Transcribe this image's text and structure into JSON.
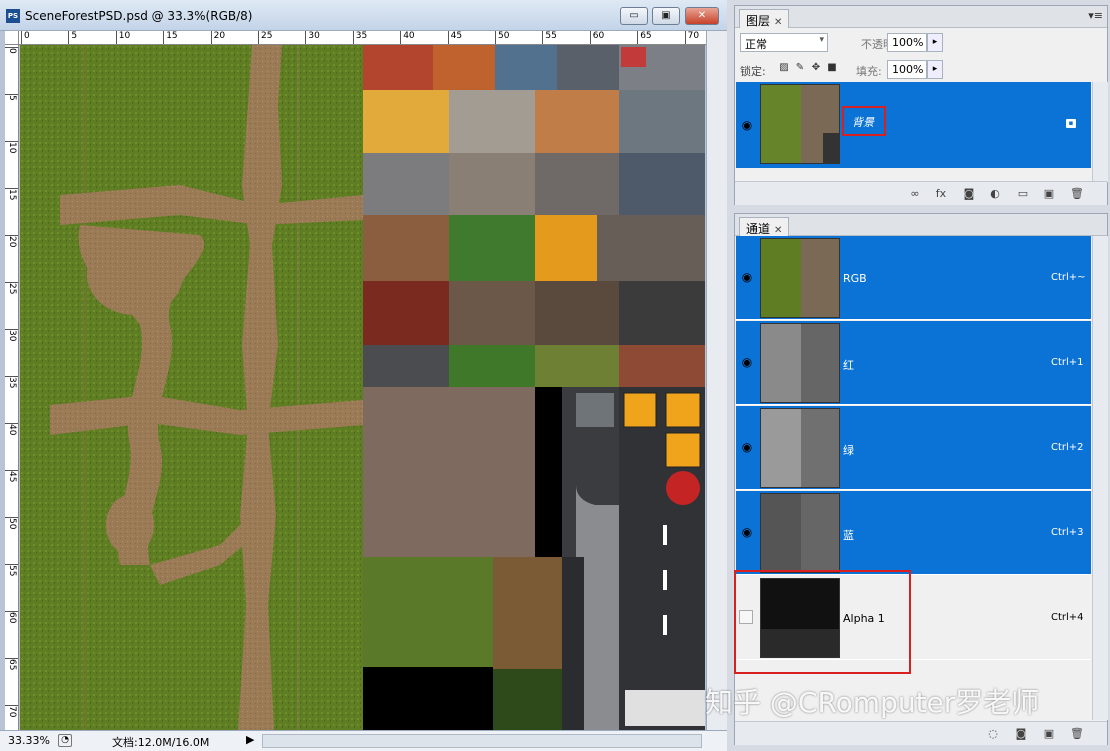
{
  "document": {
    "title": "SceneForestPSD.psd @ 33.3%(RGB/8)",
    "app_icon": "PS",
    "window_buttons": {
      "minimize": "▭",
      "maximize": "▣",
      "close": "✕"
    },
    "hruler_ticks": [
      "0",
      "5",
      "10",
      "15",
      "20",
      "25",
      "30",
      "35",
      "40",
      "45",
      "50",
      "55",
      "60",
      "65",
      "70"
    ],
    "vruler_ticks": [
      "0",
      "5",
      "10",
      "15",
      "20",
      "25",
      "30",
      "35",
      "40",
      "45",
      "50",
      "55",
      "60",
      "65",
      "70"
    ],
    "zoom": "33.33%",
    "doc_info": "文档:12.0M/16.0M",
    "status_arrow": "▶",
    "canvas_colors": {
      "grass": "#5e7a22",
      "path": "#9b7a56",
      "road": "#3a3c3f"
    }
  },
  "layers_panel": {
    "tab_label": "图层",
    "tab_close": "✕",
    "menu": "▾≡",
    "blend_mode": "正常",
    "opacity_label": "不透明度:",
    "opacity_value": "100%",
    "lock_label": "锁定:",
    "fill_label": "填充:",
    "fill_value": "100%",
    "layer": {
      "name": "背景",
      "visible_icon": "eye-icon",
      "locked": true
    },
    "footer_icons": [
      "link-icon",
      "fx-icon",
      "mask-icon",
      "adjustment-icon",
      "folder-icon",
      "new-layer-icon",
      "trash-icon"
    ]
  },
  "channels_panel": {
    "tab_label": "通道",
    "tab_close": "✕",
    "channels": [
      {
        "name": "RGB",
        "shortcut": "Ctrl+~",
        "visible": true
      },
      {
        "name": "红",
        "shortcut": "Ctrl+1",
        "visible": true
      },
      {
        "name": "绿",
        "shortcut": "Ctrl+2",
        "visible": true
      },
      {
        "name": "蓝",
        "shortcut": "Ctrl+3",
        "visible": true
      },
      {
        "name": "Alpha 1",
        "shortcut": "Ctrl+4",
        "visible": false
      }
    ],
    "footer_icons": [
      "load-selection-icon",
      "save-selection-icon",
      "new-channel-icon",
      "trash-icon"
    ]
  },
  "watermark": "知乎 @CRomputer罗老师",
  "accent_colors": {
    "selection": "#0b72d6",
    "highlight": "#d92020"
  }
}
